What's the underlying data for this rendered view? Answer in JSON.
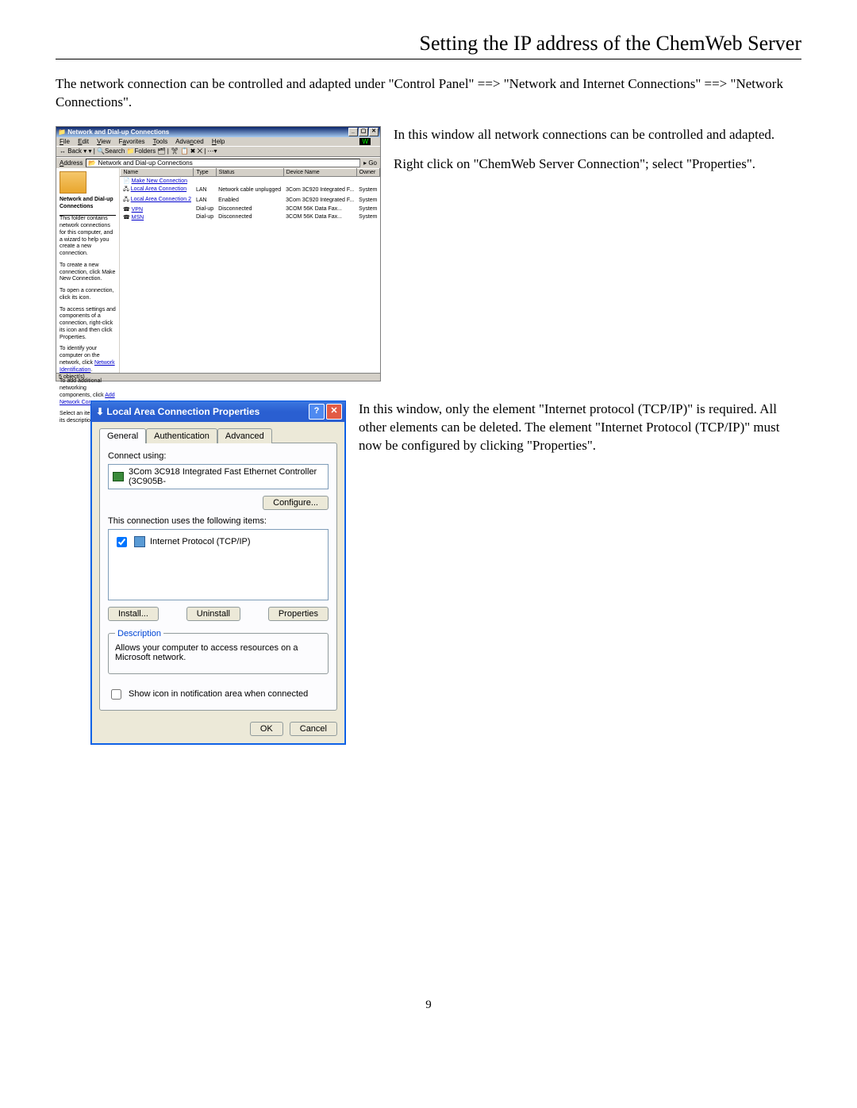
{
  "page": {
    "title": "Setting the IP address of the ChemWeb Server",
    "intro": "The network connection can be controlled and adapted under \"Control Panel\" ==> \"Network and Internet Connections\" ==> \"Network Connections\".",
    "number": "9"
  },
  "side1": {
    "p1": "In this window all network connections can be controlled and adapted.",
    "p2": "Right click on \"ChemWeb Server Connection\";  select \"Properties\"."
  },
  "side2": {
    "p1": "In this window, only the element \"Internet protocol (TCP/IP)\" is required. All other elements can be deleted. The element \"Internet Protocol (TCP/IP)\" must now be configured by clicking \"Properties\"."
  },
  "win2k": {
    "title": "Network and Dial-up Connections",
    "menu": {
      "file": "File",
      "edit": "Edit",
      "view": "View",
      "favorites": "Favorites",
      "tools": "Tools",
      "advanced": "Advanced",
      "help": "Help"
    },
    "toolbar": "↔ Back ▾  ▾  | 🔍Search  📁Folders  🗂 | ✂ 📋 ✖ ⨉ | ⋯▾",
    "address_label": "Address",
    "address_value": "Network and Dial-up Connections",
    "go": "Go",
    "sidebar": {
      "heading": "Network and Dial-up Connections",
      "p1": "This folder contains network connections for this computer, and a wizard to help you create a new connection.",
      "p2": "To create a new connection, click Make New Connection.",
      "p3": "To open a connection, click its icon.",
      "p4": "To access settings and components of a connection, right-click its icon and then click Properties.",
      "p5_a": "To identify your computer on the network, click ",
      "p5_link": "Network Identification",
      "p6_a": "To add additional networking components, click ",
      "p6_link": "Add Network Components",
      "p7": "Select an item to view its description."
    },
    "columns": {
      "name": "Name",
      "type": "Type",
      "status": "Status",
      "device": "Device Name",
      "owner": "Owner"
    },
    "rows": [
      {
        "name": "Make New Connection",
        "type": "",
        "status": "",
        "device": "",
        "owner": ""
      },
      {
        "name": "Local Area Connection",
        "type": "LAN",
        "status": "Network cable unplugged",
        "device": "3Com 3C920 Integrated F...",
        "owner": "System"
      },
      {
        "name": "Local Area Connection 2",
        "type": "LAN",
        "status": "Enabled",
        "device": "3Com 3C920 Integrated F...",
        "owner": "System"
      },
      {
        "name": "VPN",
        "type": "Dial-up",
        "status": "Disconnected",
        "device": "3COM 56K Data Fax...",
        "owner": "System"
      },
      {
        "name": "MSN",
        "type": "Dial-up",
        "status": "Disconnected",
        "device": "3COM 56K Data Fax...",
        "owner": "System"
      }
    ],
    "status": "5 object(s)"
  },
  "xp": {
    "title": "Local Area Connection Properties",
    "tabs": {
      "general": "General",
      "auth": "Authentication",
      "adv": "Advanced"
    },
    "connect_using": "Connect using:",
    "adapter": "3Com 3C918 Integrated Fast Ethernet Controller (3C905B-",
    "configure": "Configure...",
    "uses_items": "This connection uses the following items:",
    "item_tcpip": "Internet Protocol (TCP/IP)",
    "install": "Install...",
    "uninstall": "Uninstall",
    "properties": "Properties",
    "desc_legend": "Description",
    "desc_text": "Allows your computer to access resources on a Microsoft network.",
    "show_icon": "Show icon in notification area when connected",
    "ok": "OK",
    "cancel": "Cancel"
  }
}
